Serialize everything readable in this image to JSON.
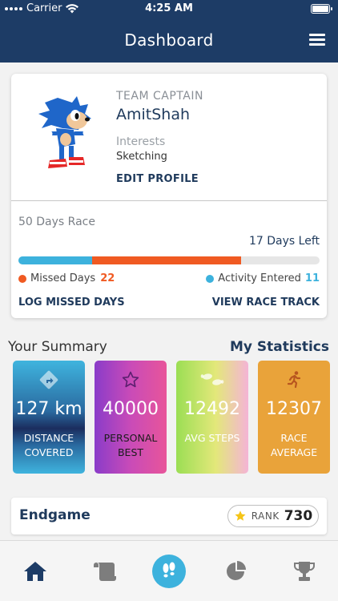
{
  "status_bar": {
    "carrier": "Carrier",
    "time": "4:25 AM"
  },
  "header": {
    "title": "Dashboard"
  },
  "profile": {
    "role": "TEAM CAPTAIN",
    "name": "AmitShah",
    "interests_label": "Interests",
    "interests_value": "Sketching",
    "edit_label": "EDIT PROFILE"
  },
  "race": {
    "title": "50 Days Race",
    "days_left": "17 Days Left",
    "progress": {
      "activity_fraction": 0.245,
      "missed_fraction": 0.495
    },
    "missed_label": "Missed Days",
    "missed_count": "22",
    "activity_label": "Activity Entered",
    "activity_count": "11",
    "log_missed_label": "LOG MISSED DAYS",
    "view_track_label": "VIEW RACE TRACK",
    "colors": {
      "activity": "#3db2dd",
      "missed": "#f05a22",
      "track": "#e6e6e6"
    }
  },
  "summary": {
    "title": "Your Summary",
    "my_stats_label": "My Statistics",
    "tiles": [
      {
        "value": "127 km",
        "label_line1": "DISTANCE",
        "label_line2": "COVERED",
        "icon": "turn-right-arrow-icon"
      },
      {
        "value": "40000",
        "label_line1": "PERSONAL",
        "label_line2": "BEST",
        "icon": "star-outline-icon"
      },
      {
        "value": "12492",
        "label_line1": "AVG STEPS",
        "label_line2": "",
        "icon": "footprints-icon"
      },
      {
        "value": "12307",
        "label_line1": "RACE",
        "label_line2": "AVERAGE",
        "icon": "runner-icon"
      }
    ]
  },
  "endgame": {
    "title": "Endgame",
    "rank_label": "RANK",
    "rank_value": "730"
  },
  "nav": {
    "items": [
      "home-icon",
      "scroll-icon",
      "footprints-icon",
      "pie-chart-icon",
      "trophy-icon"
    ]
  }
}
